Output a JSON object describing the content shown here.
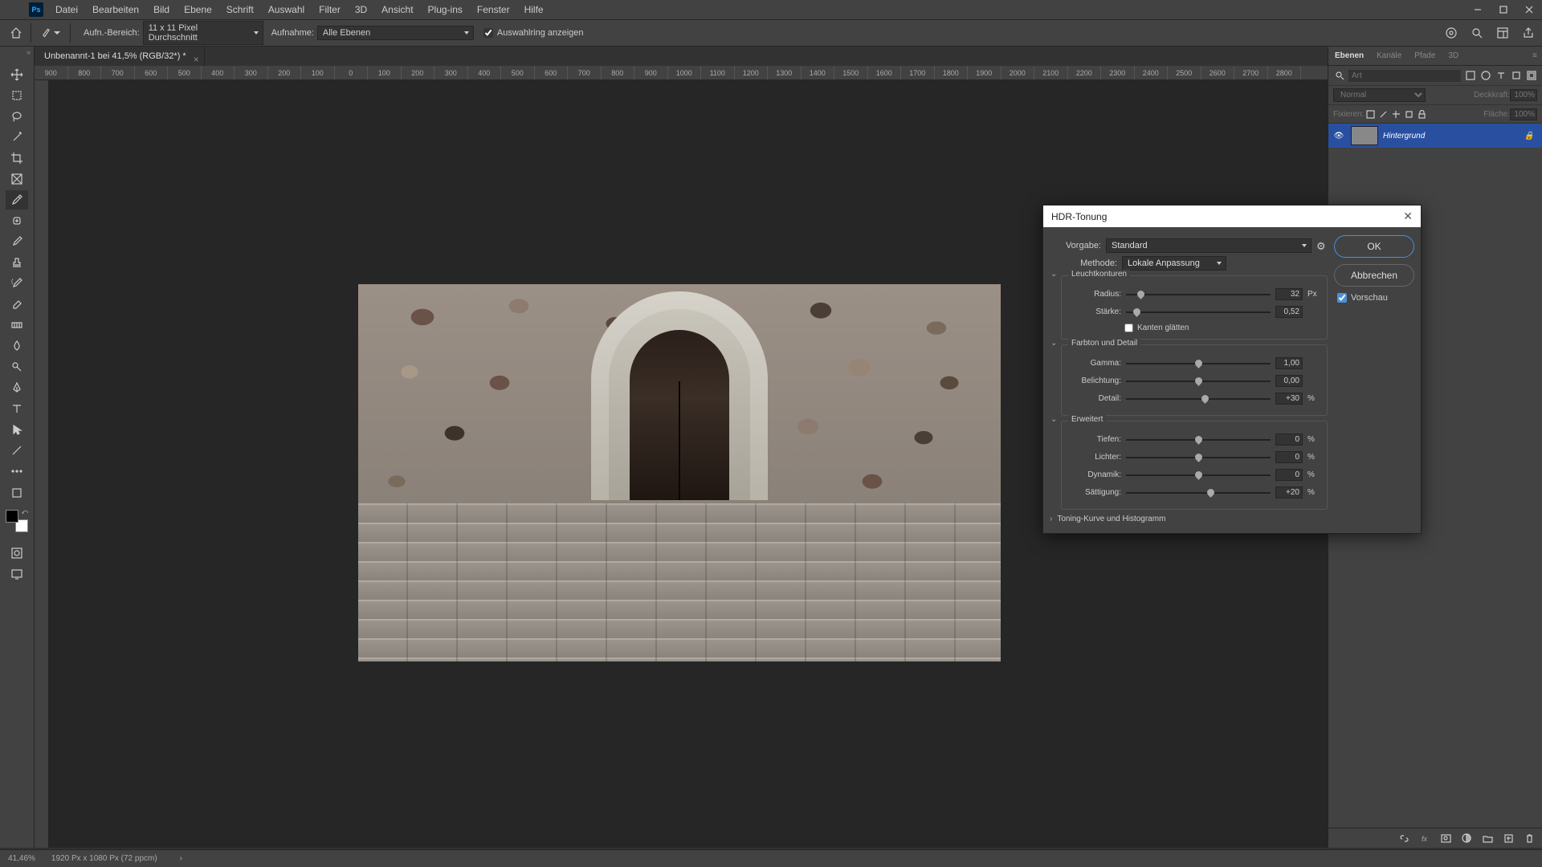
{
  "menu": [
    "Datei",
    "Bearbeiten",
    "Bild",
    "Ebene",
    "Schrift",
    "Auswahl",
    "Filter",
    "3D",
    "Ansicht",
    "Plug-ins",
    "Fenster",
    "Hilfe"
  ],
  "options": {
    "range_label": "Aufn.-Bereich:",
    "range_value": "11 x 11 Pixel Durchschnitt",
    "sample_label": "Aufnahme:",
    "sample_value": "Alle Ebenen",
    "show_sel": "Auswahlring anzeigen"
  },
  "doc_tab": "Unbenannt-1 bei 41,5% (RGB/32*) *",
  "ruler_h": [
    "900",
    "800",
    "700",
    "600",
    "500",
    "400",
    "300",
    "200",
    "100",
    "0",
    "100",
    "200",
    "300",
    "400",
    "500",
    "600",
    "700",
    "800",
    "900",
    "1000",
    "1100",
    "1200",
    "1300",
    "1400",
    "1500",
    "1600",
    "1700",
    "1800",
    "1900",
    "2000",
    "2100",
    "2200",
    "2300",
    "2400",
    "2500",
    "2600",
    "2700",
    "2800"
  ],
  "panels": {
    "tabs": [
      "Ebenen",
      "Kanäle",
      "Pfade",
      "3D"
    ],
    "filter_placeholder": "Art",
    "blend_mode": "Normal",
    "opacity_label": "Deckkraft:",
    "opacity_value": "100%",
    "lock_label": "Fixieren:",
    "fill_label": "Fläche:",
    "fill_value": "100%",
    "layer_name": "Hintergrund"
  },
  "dialog": {
    "title": "HDR-Tonung",
    "preset_label": "Vorgabe:",
    "preset_value": "Standard",
    "method_label": "Methode:",
    "method_value": "Lokale Anpassung",
    "ok": "OK",
    "cancel": "Abbrechen",
    "preview": "Vorschau",
    "sec_glow": "Leuchtkonturen",
    "radius_label": "Radius:",
    "radius_val": "32",
    "radius_unit": "Px",
    "strength_label": "Stärke:",
    "strength_val": "0,52",
    "smooth_edges": "Kanten glätten",
    "sec_tone": "Farbton und Detail",
    "gamma_label": "Gamma:",
    "gamma_val": "1,00",
    "exposure_label": "Belichtung:",
    "exposure_val": "0,00",
    "detail_label": "Detail:",
    "detail_val": "+30",
    "pct": "%",
    "sec_adv": "Erweitert",
    "shadow_label": "Tiefen:",
    "shadow_val": "0",
    "highlight_label": "Lichter:",
    "highlight_val": "0",
    "vibrance_label": "Dynamik:",
    "vibrance_val": "0",
    "saturation_label": "Sättigung:",
    "saturation_val": "+20",
    "curve_section": "Toning-Kurve und Histogramm"
  },
  "status": {
    "zoom": "41,46%",
    "dims": "1920 Px x 1080 Px (72 ppcm)"
  }
}
